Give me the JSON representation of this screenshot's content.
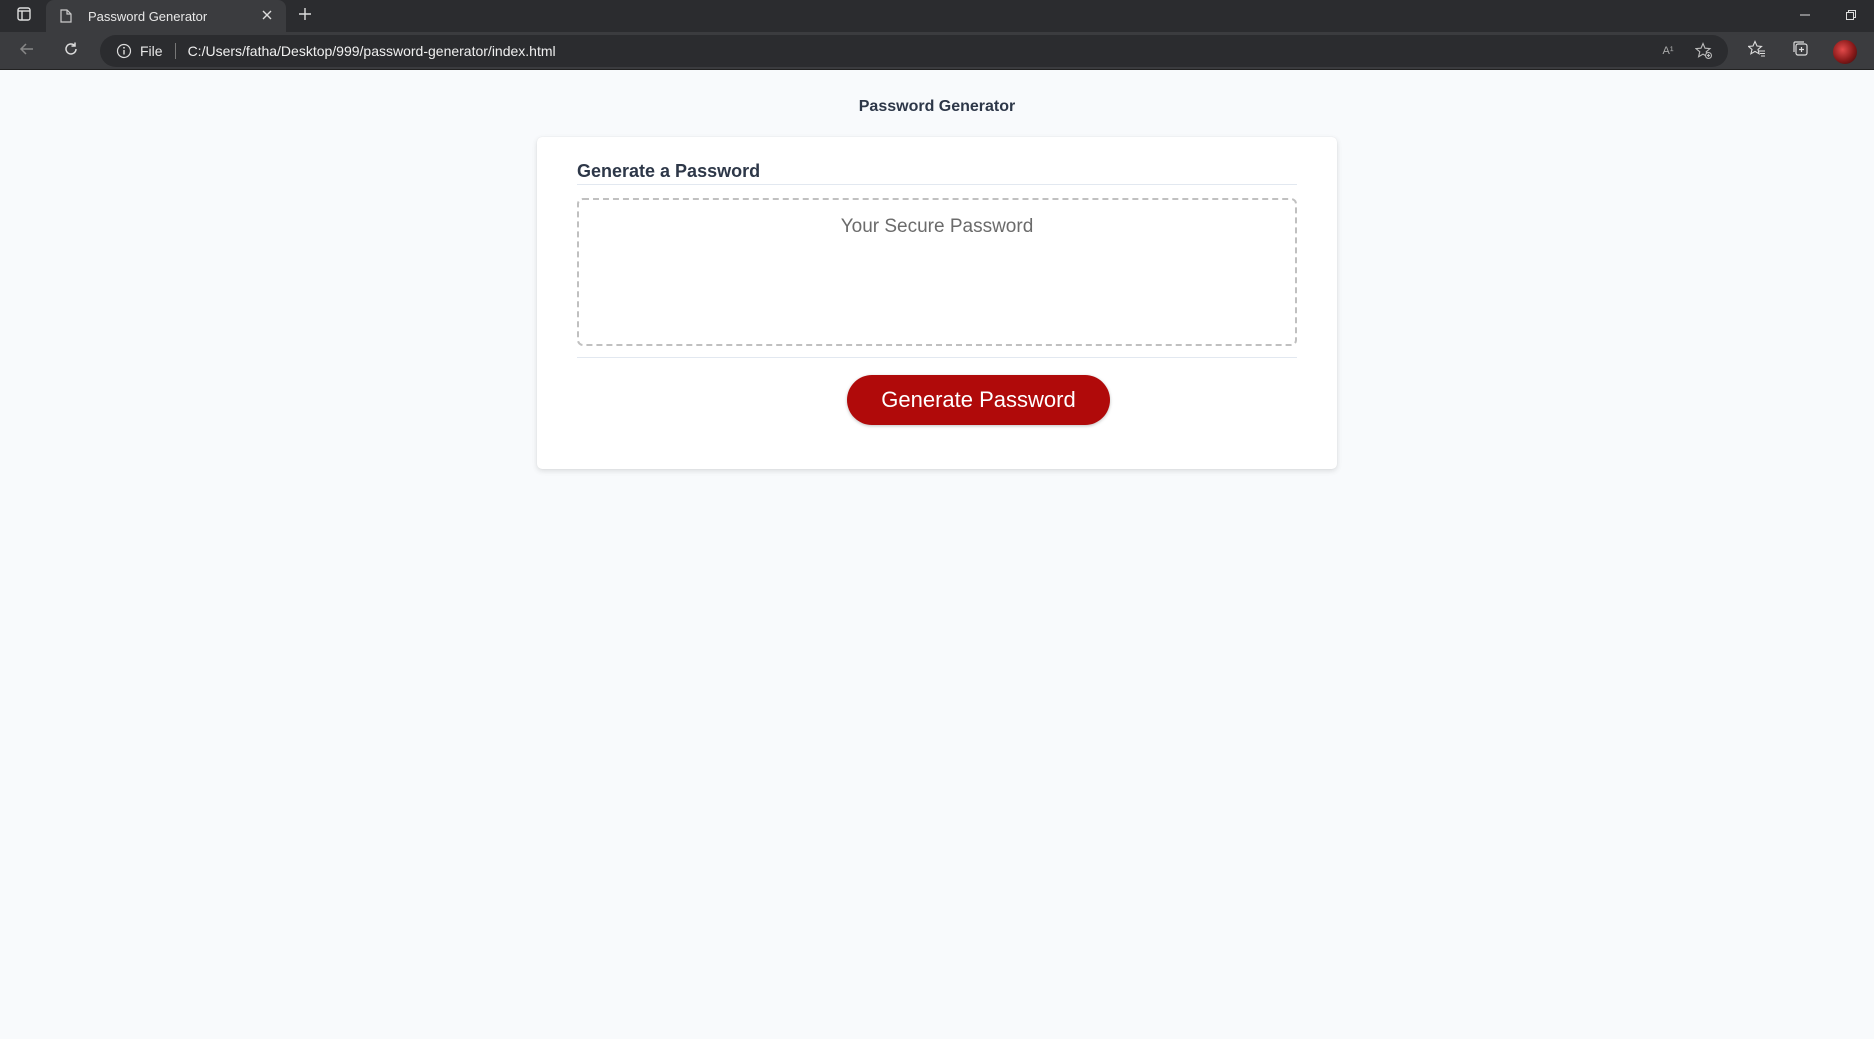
{
  "browser": {
    "tab": {
      "title": "Password Generator",
      "close_glyph": "✕"
    },
    "new_tab_glyph": "+",
    "address": {
      "scheme": "File",
      "url": "C:/Users/fatha/Desktop/999/password-generator/index.html"
    },
    "read_aloud_label": "A¹"
  },
  "page": {
    "title": "Password Generator",
    "card": {
      "heading": "Generate a Password",
      "password_placeholder": "Your Secure Password",
      "password_value": "",
      "generate_label": "Generate Password"
    }
  },
  "colors": {
    "button_bg": "#b00a0a",
    "page_bg": "#f8fafc",
    "text_dark": "#2d3748"
  },
  "icons": [
    "tab-actions-icon",
    "page-icon",
    "close-icon",
    "plus-icon",
    "back-arrow-icon",
    "refresh-icon",
    "info-icon",
    "read-aloud-icon",
    "add-favorite-icon",
    "favorites-icon",
    "collections-icon",
    "minimize-icon",
    "restore-icon"
  ]
}
